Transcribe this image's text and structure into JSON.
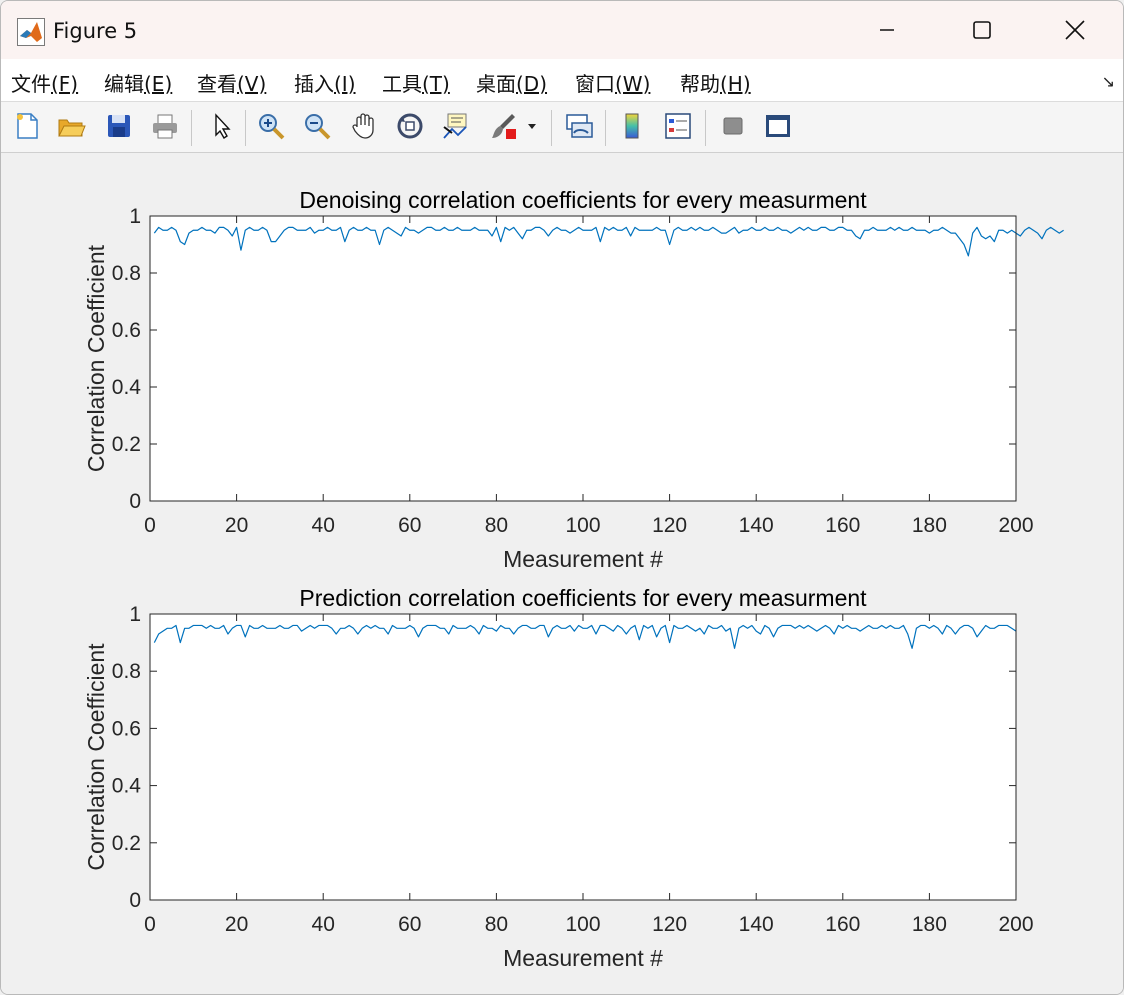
{
  "window": {
    "title": "Figure 5",
    "icon": "matlab-icon"
  },
  "menu": [
    {
      "label": "文件",
      "key": "(F)"
    },
    {
      "label": "编辑",
      "key": "(E)"
    },
    {
      "label": "查看",
      "key": "(V)"
    },
    {
      "label": "插入",
      "key": "(I)"
    },
    {
      "label": "工具",
      "key": "(T)"
    },
    {
      "label": "桌面",
      "key": "(D)"
    },
    {
      "label": "窗口",
      "key": "(W)"
    },
    {
      "label": "帮助",
      "key": "(H)"
    }
  ],
  "toolbar_icons": [
    "new-figure-icon",
    "open-file-icon",
    "save-icon",
    "print-icon",
    "select-arrow-icon",
    "zoom-in-icon",
    "zoom-out-icon",
    "pan-hand-icon",
    "rotate-3d-icon",
    "data-cursor-icon",
    "brush-icon",
    "link-plot-icon",
    "colorbar-icon",
    "legend-icon",
    "hide-plot-tools-icon",
    "show-plot-tools-icon"
  ],
  "colors": {
    "line": "#0072bd",
    "axes": "#262626",
    "plot_bg": "#ffffff",
    "figure_bg": "#f0f0f0"
  },
  "chart_data": [
    {
      "type": "line",
      "title": "Denoising correlation coefficients for every measurment",
      "xlabel": "Measurement #",
      "ylabel": "Correlation Coefficient",
      "xlim": [
        0,
        200
      ],
      "ylim": [
        0,
        1
      ],
      "xticks": [
        0,
        20,
        40,
        60,
        80,
        100,
        120,
        140,
        160,
        180,
        200
      ],
      "yticks": [
        0,
        0.2,
        0.4,
        0.6,
        0.8,
        1
      ],
      "ytick_labels": [
        "0",
        "0.2",
        "0.4",
        "0.6",
        "0.8",
        "1"
      ],
      "grid": false,
      "series": [
        {
          "color": "#0072bd",
          "x_start": 1,
          "x_step": 1,
          "values": [
            0.94,
            0.96,
            0.95,
            0.95,
            0.96,
            0.95,
            0.91,
            0.9,
            0.94,
            0.95,
            0.95,
            0.96,
            0.95,
            0.95,
            0.94,
            0.96,
            0.96,
            0.95,
            0.93,
            0.96,
            0.88,
            0.95,
            0.96,
            0.95,
            0.95,
            0.96,
            0.95,
            0.91,
            0.91,
            0.93,
            0.95,
            0.96,
            0.96,
            0.95,
            0.95,
            0.95,
            0.96,
            0.94,
            0.95,
            0.95,
            0.96,
            0.95,
            0.95,
            0.96,
            0.91,
            0.95,
            0.96,
            0.95,
            0.95,
            0.96,
            0.95,
            0.95,
            0.9,
            0.95,
            0.96,
            0.95,
            0.94,
            0.93,
            0.96,
            0.95,
            0.95,
            0.94,
            0.95,
            0.96,
            0.96,
            0.95,
            0.95,
            0.96,
            0.95,
            0.95,
            0.96,
            0.95,
            0.95,
            0.95,
            0.96,
            0.95,
            0.95,
            0.95,
            0.93,
            0.96,
            0.91,
            0.96,
            0.95,
            0.96,
            0.94,
            0.92,
            0.95,
            0.95,
            0.96,
            0.96,
            0.95,
            0.93,
            0.95,
            0.96,
            0.95,
            0.95,
            0.94,
            0.95,
            0.96,
            0.95,
            0.95,
            0.95,
            0.96,
            0.91,
            0.96,
            0.95,
            0.96,
            0.95,
            0.95,
            0.96,
            0.93,
            0.96,
            0.95,
            0.95,
            0.95,
            0.95,
            0.96,
            0.95,
            0.95,
            0.9,
            0.95,
            0.96,
            0.95,
            0.95,
            0.96,
            0.95,
            0.96,
            0.95,
            0.95,
            0.96,
            0.95,
            0.94,
            0.94,
            0.95,
            0.96,
            0.94,
            0.95,
            0.95,
            0.96,
            0.95,
            0.95,
            0.96,
            0.95,
            0.95,
            0.96,
            0.95,
            0.95,
            0.94,
            0.95,
            0.96,
            0.95,
            0.96,
            0.95,
            0.95,
            0.96,
            0.96,
            0.95,
            0.95,
            0.96,
            0.96,
            0.95,
            0.95,
            0.93,
            0.92,
            0.95,
            0.95,
            0.96,
            0.95,
            0.95,
            0.95,
            0.96,
            0.95,
            0.96,
            0.95,
            0.95,
            0.96,
            0.95,
            0.95,
            0.95,
            0.94,
            0.95,
            0.95,
            0.96,
            0.95,
            0.94,
            0.94,
            0.92,
            0.9,
            0.86,
            0.94,
            0.96,
            0.93,
            0.92,
            0.93,
            0.91,
            0.95,
            0.95,
            0.94,
            0.95,
            0.94,
            0.93,
            0.95,
            0.96,
            0.95,
            0.94,
            0.92,
            0.95,
            0.96,
            0.95,
            0.94,
            0.95
          ]
        }
      ]
    },
    {
      "type": "line",
      "title": "Prediction correlation coefficients for every measurment",
      "xlabel": "Measurement #",
      "ylabel": "Correlation Coefficient",
      "xlim": [
        0,
        200
      ],
      "ylim": [
        0,
        1
      ],
      "xticks": [
        0,
        20,
        40,
        60,
        80,
        100,
        120,
        140,
        160,
        180,
        200
      ],
      "yticks": [
        0,
        0.2,
        0.4,
        0.6,
        0.8,
        1
      ],
      "ytick_labels": [
        "0",
        "0.2",
        "0.4",
        "0.6",
        "0.8",
        "1"
      ],
      "grid": false,
      "series": [
        {
          "color": "#0072bd",
          "x_start": 1,
          "x_step": 1,
          "values": [
            0.9,
            0.93,
            0.94,
            0.95,
            0.95,
            0.96,
            0.9,
            0.95,
            0.95,
            0.96,
            0.96,
            0.96,
            0.95,
            0.96,
            0.95,
            0.95,
            0.96,
            0.93,
            0.95,
            0.96,
            0.96,
            0.92,
            0.96,
            0.95,
            0.95,
            0.96,
            0.95,
            0.95,
            0.95,
            0.96,
            0.95,
            0.95,
            0.96,
            0.96,
            0.94,
            0.95,
            0.96,
            0.95,
            0.96,
            0.96,
            0.96,
            0.95,
            0.93,
            0.95,
            0.95,
            0.96,
            0.95,
            0.93,
            0.95,
            0.96,
            0.95,
            0.96,
            0.95,
            0.95,
            0.93,
            0.96,
            0.95,
            0.95,
            0.95,
            0.96,
            0.95,
            0.92,
            0.95,
            0.96,
            0.96,
            0.96,
            0.95,
            0.95,
            0.93,
            0.96,
            0.95,
            0.95,
            0.95,
            0.96,
            0.95,
            0.93,
            0.96,
            0.95,
            0.95,
            0.94,
            0.96,
            0.95,
            0.95,
            0.93,
            0.95,
            0.96,
            0.96,
            0.95,
            0.95,
            0.96,
            0.96,
            0.92,
            0.95,
            0.96,
            0.95,
            0.95,
            0.96,
            0.94,
            0.96,
            0.95,
            0.95,
            0.96,
            0.93,
            0.96,
            0.96,
            0.95,
            0.94,
            0.96,
            0.95,
            0.93,
            0.95,
            0.96,
            0.91,
            0.96,
            0.95,
            0.96,
            0.92,
            0.95,
            0.96,
            0.9,
            0.96,
            0.95,
            0.95,
            0.96,
            0.95,
            0.94,
            0.95,
            0.93,
            0.96,
            0.95,
            0.95,
            0.96,
            0.94,
            0.95,
            0.88,
            0.95,
            0.96,
            0.95,
            0.96,
            0.94,
            0.93,
            0.96,
            0.95,
            0.92,
            0.95,
            0.96,
            0.96,
            0.96,
            0.95,
            0.96,
            0.95,
            0.96,
            0.95,
            0.94,
            0.95,
            0.96,
            0.95,
            0.93,
            0.96,
            0.95,
            0.96,
            0.95,
            0.95,
            0.94,
            0.95,
            0.96,
            0.95,
            0.95,
            0.96,
            0.95,
            0.96,
            0.95,
            0.95,
            0.96,
            0.93,
            0.88,
            0.95,
            0.96,
            0.96,
            0.95,
            0.96,
            0.95,
            0.93,
            0.96,
            0.95,
            0.93,
            0.95,
            0.96,
            0.96,
            0.95,
            0.92,
            0.94,
            0.96,
            0.95,
            0.95,
            0.96,
            0.96,
            0.96,
            0.95,
            0.94
          ]
        }
      ]
    }
  ]
}
